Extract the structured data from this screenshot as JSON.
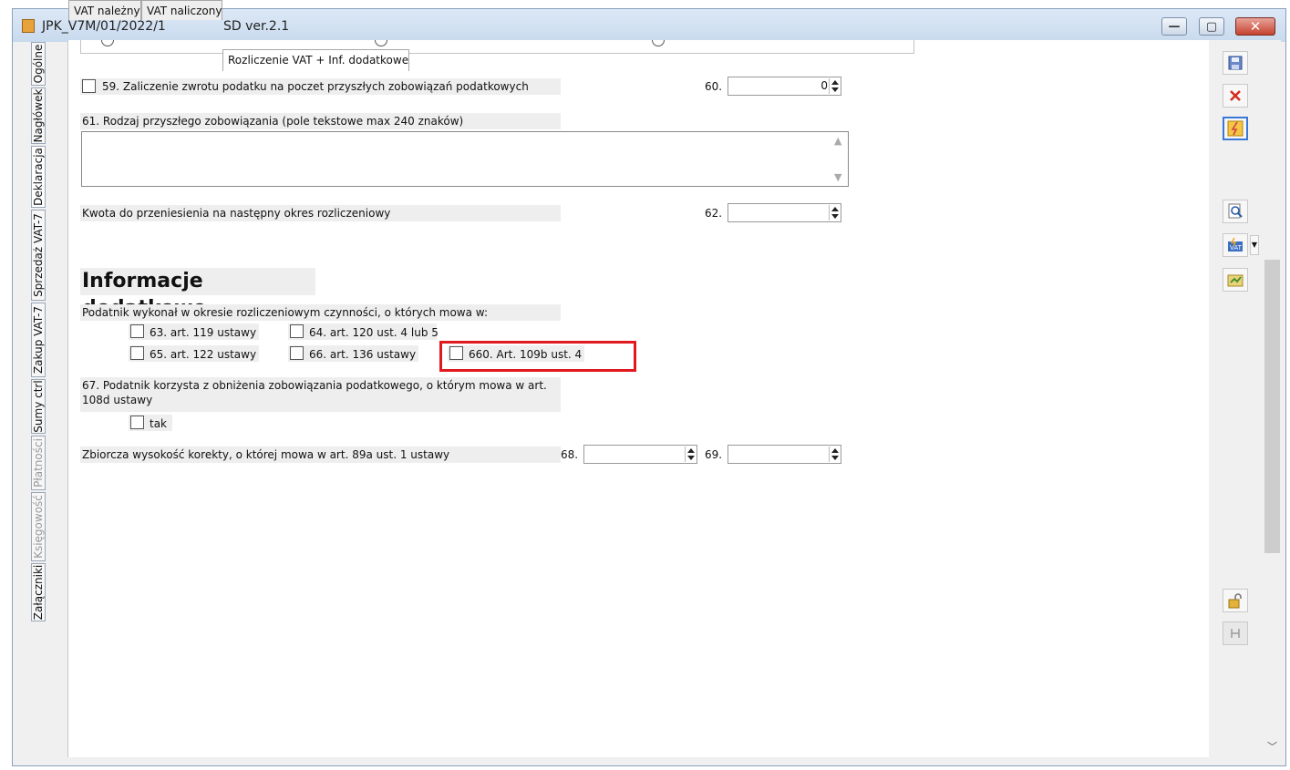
{
  "window": {
    "title": "JPK_V7M/01/2022/1",
    "version": "SD ver.2.1"
  },
  "window_buttons": {
    "minimize": "—",
    "maximize": "▢",
    "close": "✕"
  },
  "side_tabs": [
    {
      "label": "Ogólne",
      "disabled": false
    },
    {
      "label": "Nagłówek",
      "disabled": false
    },
    {
      "label": "Deklaracja",
      "disabled": false
    },
    {
      "label": "Sprzedaż VAT-7",
      "disabled": false
    },
    {
      "label": "Zakup VAT-7",
      "disabled": false
    },
    {
      "label": "Sumy ctrl",
      "disabled": false
    },
    {
      "label": "Płatności",
      "disabled": true
    },
    {
      "label": "Księgowość",
      "disabled": true
    },
    {
      "label": "Załączniki",
      "disabled": false
    }
  ],
  "tabs": [
    {
      "label": "VAT należny",
      "active": false
    },
    {
      "label": "VAT naliczony",
      "active": false
    },
    {
      "label": "Rozliczenie VAT + Inf. dodatkowe",
      "active": true
    }
  ],
  "fields": {
    "f59_label": "59. Zaliczenie zwrotu podatku na poczet przyszłych zobowiązań podatkowych",
    "f59_checked": false,
    "f60_label": "60.",
    "f60_value": "0",
    "f61_label": "61. Rodzaj przyszłego zobowiązania (pole tekstowe max 240 znaków)",
    "f61_value": "",
    "kwota_label": "Kwota do przeniesienia na następny okres rozliczeniowy",
    "f62_label": "62.",
    "f62_value": ""
  },
  "info": {
    "title": "Informacje dodatkowe",
    "intro": "Podatnik wykonał w okresie rozliczeniowym czynności, o których mowa w:",
    "options": {
      "o63": "63. art. 119 ustawy",
      "o64": "64. art. 120 ust. 4 lub 5",
      "o65": "65. art. 122 ustawy",
      "o66": "66. art. 136 ustawy",
      "o660": "660. Art. 109b ust. 4"
    },
    "f67_label": "67. Podatnik korzysta z obniżenia zobowiązania podatkowego, o którym mowa w art. 108d ustawy",
    "f67_option": "tak",
    "korekta_label": "Zbiorcza wysokość korekty, o której mowa w art. 89a ust. 1 ustawy",
    "f68_label": "68.",
    "f68_value": "",
    "f69_label": "69.",
    "f69_value": ""
  },
  "toolbar_icons": [
    "save-icon",
    "delete-icon",
    "calculate-icon",
    "preview-icon",
    "vat-icon",
    "export-icon",
    "unlock-icon",
    "pin-icon"
  ],
  "colors": {
    "highlight": "#e0191f",
    "label_bg": "#eeeeee"
  }
}
